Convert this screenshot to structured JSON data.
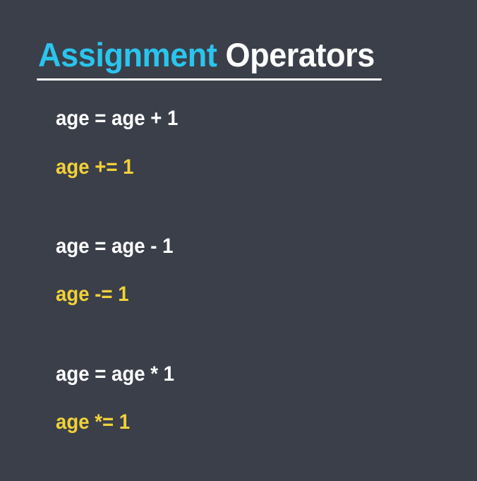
{
  "title": {
    "accent": "Assignment",
    "main": "Operators"
  },
  "colors": {
    "background": "#3b3f49",
    "title_accent": "#29c5ee",
    "title_main": "#ffffff",
    "plain_text": "#ffffff",
    "shorthand_text": "#f1d139"
  },
  "examples": [
    {
      "long": "age = age + 1",
      "short": "age += 1"
    },
    {
      "long": "age = age - 1",
      "short": "age -= 1"
    },
    {
      "long": "age = age * 1",
      "short": "age *= 1"
    }
  ]
}
